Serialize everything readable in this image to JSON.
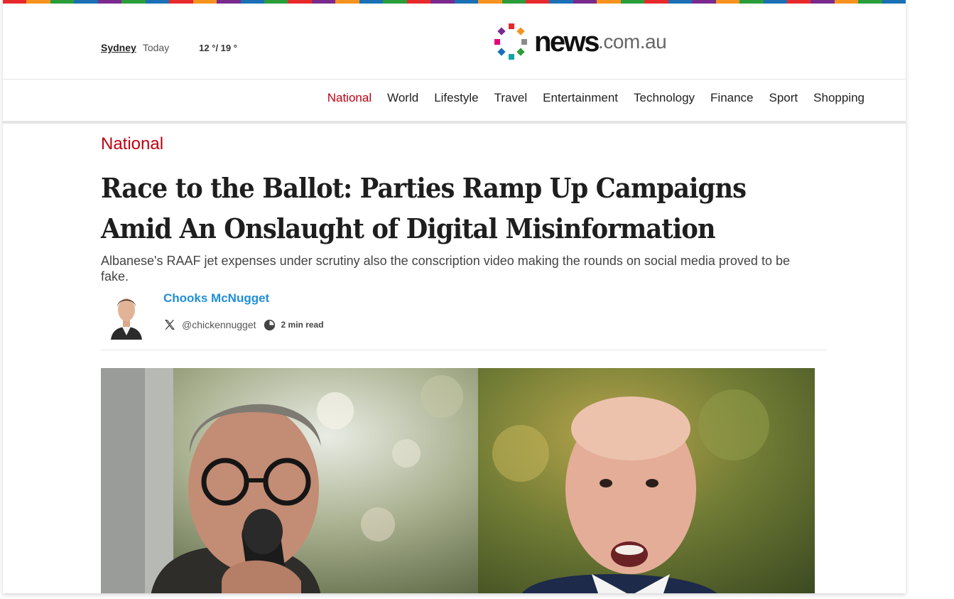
{
  "brand": {
    "logo_main": "news",
    "logo_domain": ".com.au",
    "strip_colors": [
      "#e8292b",
      "#f7921e",
      "#2a9d3a",
      "#1a6fb5",
      "#7a2a8e",
      "#2a9d3a",
      "#1a6fb5",
      "#e8292b",
      "#f7921e",
      "#7a2a8e",
      "#1a6fb5",
      "#2a9d3a",
      "#e8292b",
      "#7a2a8e",
      "#f7921e",
      "#1a6fb5",
      "#2a9d3a",
      "#e8292b",
      "#7a2a8e",
      "#1a6fb5",
      "#f7921e",
      "#2a9d3a",
      "#e8292b",
      "#1a6fb5",
      "#7a2a8e",
      "#f7921e",
      "#2a9d3a",
      "#e8292b",
      "#1a6fb5",
      "#7a2a8e",
      "#f7921e",
      "#2a9d3a",
      "#1a6fb5",
      "#e8292b",
      "#7a2a8e",
      "#f7921e",
      "#2a9d3a",
      "#1a6fb5"
    ]
  },
  "weather": {
    "city": "Sydney",
    "day": "Today",
    "temp": "12 °/ 19 °"
  },
  "nav": {
    "items": [
      {
        "label": "National",
        "active": true
      },
      {
        "label": "World"
      },
      {
        "label": "Lifestyle"
      },
      {
        "label": "Travel"
      },
      {
        "label": "Entertainment"
      },
      {
        "label": "Technology"
      },
      {
        "label": "Finance"
      },
      {
        "label": "Sport"
      },
      {
        "label": "Shopping"
      }
    ]
  },
  "article": {
    "section": "National",
    "headline": "Race to the Ballot: Parties Ramp Up Campaigns Amid An Onslaught of Digital Misinformation",
    "standfirst": "Albanese's RAAF jet expenses under scrutiny also the conscription video making the rounds on social media proved to be fake.",
    "author": {
      "name": "Chooks McNugget",
      "handle": "@chickennugget",
      "read_time": "2 min read"
    }
  },
  "icons": {
    "social": "x-icon",
    "time": "clock-icon"
  },
  "colors": {
    "accent": "#c00011",
    "author_link": "#1f8fd6"
  }
}
